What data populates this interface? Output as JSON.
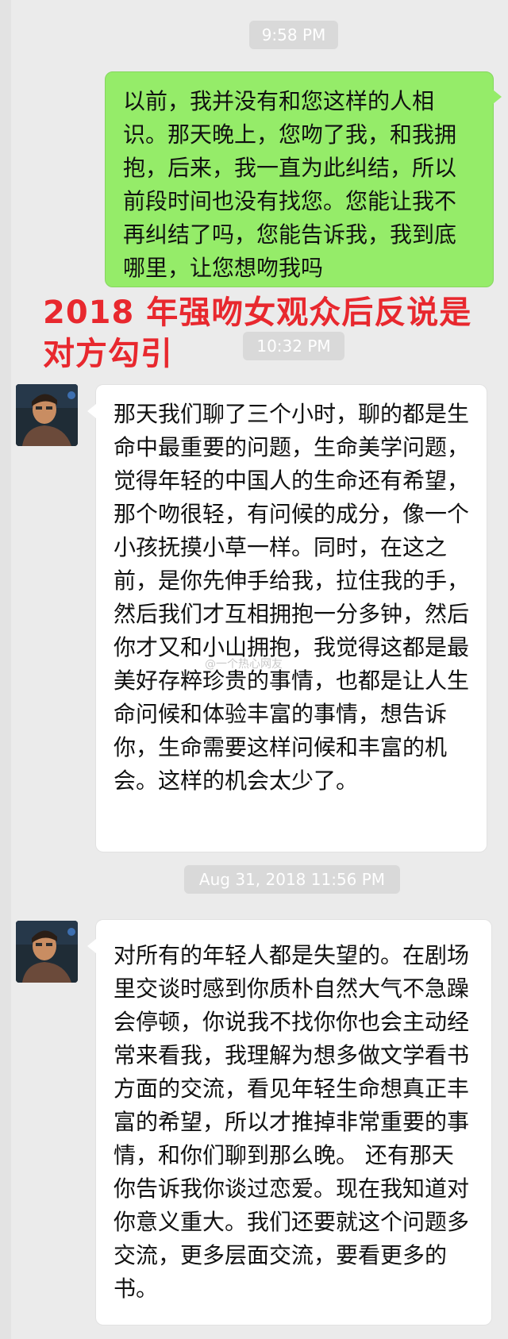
{
  "timestamps": [
    "9:58 PM",
    "10:32 PM",
    "Aug 31, 2018 11:56 PM"
  ],
  "messages": {
    "outgoing_1": "以前，我并没有和您这样的人相识。那天晚上，您吻了我，和我拥抱，后来，我一直为此纠结，所以前段时间也没有找您。您能让我不再纠结了吗，您能告诉我，我到底哪里，让您想吻我吗",
    "incoming_1": "那天我们聊了三个小时，聊的都是生命中最重要的问题，生命美学问题，觉得年轻的中国人的生命还有希望，那个吻很轻，有问候的成分，像一个小孩抚摸小草一样。同时，在这之前，是你先伸手给我，拉住我的手，然后我们才互相拥抱一分多钟，然后你才又和小山拥抱，我觉得这都是最美好存粹珍贵的事情，也都是让人生命问候和体验丰富的事情，想告诉你，生命需要这样问候和丰富的机会。这样的机会太少了。",
    "incoming_2": "对所有的年轻人都是失望的。在剧场里交谈时感到你质朴自然大气不急躁会停顿，你说我不找你你也会主动经常来看我，我理解为想多做文学看书方面的交流，看见年轻生命想真正丰富的希望，所以才推掉非常重要的事情，和你们聊到那么晚。 还有那天你告诉我你谈过恋爱。现在我知道对你意义重大。我们还要就这个问题多交流，更多层面交流，要看更多的书。"
  },
  "overlay_caption": "2018 年强吻女观众后反说是对方勾引",
  "watermark": "@一个热心网友",
  "colors": {
    "outgoing_bubble": "#95ec69",
    "incoming_bubble": "#ffffff",
    "background": "#ebebeb",
    "caption": "#e8282e"
  }
}
